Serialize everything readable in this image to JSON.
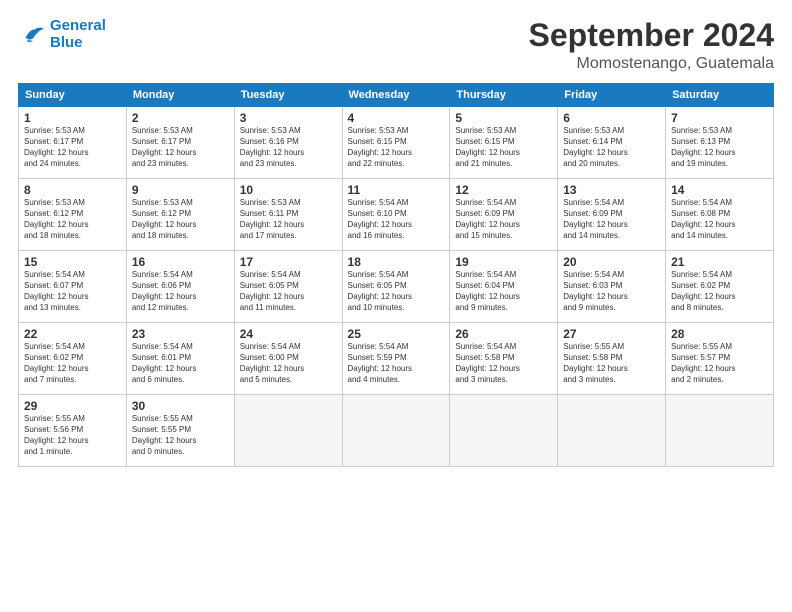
{
  "logo": {
    "line1": "General",
    "line2": "Blue"
  },
  "title": "September 2024",
  "subtitle": "Momostenango, Guatemala",
  "headers": [
    "Sunday",
    "Monday",
    "Tuesday",
    "Wednesday",
    "Thursday",
    "Friday",
    "Saturday"
  ],
  "weeks": [
    [
      {
        "num": "1",
        "info": "Sunrise: 5:53 AM\nSunset: 6:17 PM\nDaylight: 12 hours\nand 24 minutes."
      },
      {
        "num": "2",
        "info": "Sunrise: 5:53 AM\nSunset: 6:17 PM\nDaylight: 12 hours\nand 23 minutes."
      },
      {
        "num": "3",
        "info": "Sunrise: 5:53 AM\nSunset: 6:16 PM\nDaylight: 12 hours\nand 23 minutes."
      },
      {
        "num": "4",
        "info": "Sunrise: 5:53 AM\nSunset: 6:15 PM\nDaylight: 12 hours\nand 22 minutes."
      },
      {
        "num": "5",
        "info": "Sunrise: 5:53 AM\nSunset: 6:15 PM\nDaylight: 12 hours\nand 21 minutes."
      },
      {
        "num": "6",
        "info": "Sunrise: 5:53 AM\nSunset: 6:14 PM\nDaylight: 12 hours\nand 20 minutes."
      },
      {
        "num": "7",
        "info": "Sunrise: 5:53 AM\nSunset: 6:13 PM\nDaylight: 12 hours\nand 19 minutes."
      }
    ],
    [
      {
        "num": "8",
        "info": "Sunrise: 5:53 AM\nSunset: 6:12 PM\nDaylight: 12 hours\nand 18 minutes."
      },
      {
        "num": "9",
        "info": "Sunrise: 5:53 AM\nSunset: 6:12 PM\nDaylight: 12 hours\nand 18 minutes."
      },
      {
        "num": "10",
        "info": "Sunrise: 5:53 AM\nSunset: 6:11 PM\nDaylight: 12 hours\nand 17 minutes."
      },
      {
        "num": "11",
        "info": "Sunrise: 5:54 AM\nSunset: 6:10 PM\nDaylight: 12 hours\nand 16 minutes."
      },
      {
        "num": "12",
        "info": "Sunrise: 5:54 AM\nSunset: 6:09 PM\nDaylight: 12 hours\nand 15 minutes."
      },
      {
        "num": "13",
        "info": "Sunrise: 5:54 AM\nSunset: 6:09 PM\nDaylight: 12 hours\nand 14 minutes."
      },
      {
        "num": "14",
        "info": "Sunrise: 5:54 AM\nSunset: 6:08 PM\nDaylight: 12 hours\nand 14 minutes."
      }
    ],
    [
      {
        "num": "15",
        "info": "Sunrise: 5:54 AM\nSunset: 6:07 PM\nDaylight: 12 hours\nand 13 minutes."
      },
      {
        "num": "16",
        "info": "Sunrise: 5:54 AM\nSunset: 6:06 PM\nDaylight: 12 hours\nand 12 minutes."
      },
      {
        "num": "17",
        "info": "Sunrise: 5:54 AM\nSunset: 6:05 PM\nDaylight: 12 hours\nand 11 minutes."
      },
      {
        "num": "18",
        "info": "Sunrise: 5:54 AM\nSunset: 6:05 PM\nDaylight: 12 hours\nand 10 minutes."
      },
      {
        "num": "19",
        "info": "Sunrise: 5:54 AM\nSunset: 6:04 PM\nDaylight: 12 hours\nand 9 minutes."
      },
      {
        "num": "20",
        "info": "Sunrise: 5:54 AM\nSunset: 6:03 PM\nDaylight: 12 hours\nand 9 minutes."
      },
      {
        "num": "21",
        "info": "Sunrise: 5:54 AM\nSunset: 6:02 PM\nDaylight: 12 hours\nand 8 minutes."
      }
    ],
    [
      {
        "num": "22",
        "info": "Sunrise: 5:54 AM\nSunset: 6:02 PM\nDaylight: 12 hours\nand 7 minutes."
      },
      {
        "num": "23",
        "info": "Sunrise: 5:54 AM\nSunset: 6:01 PM\nDaylight: 12 hours\nand 6 minutes."
      },
      {
        "num": "24",
        "info": "Sunrise: 5:54 AM\nSunset: 6:00 PM\nDaylight: 12 hours\nand 5 minutes."
      },
      {
        "num": "25",
        "info": "Sunrise: 5:54 AM\nSunset: 5:59 PM\nDaylight: 12 hours\nand 4 minutes."
      },
      {
        "num": "26",
        "info": "Sunrise: 5:54 AM\nSunset: 5:58 PM\nDaylight: 12 hours\nand 3 minutes."
      },
      {
        "num": "27",
        "info": "Sunrise: 5:55 AM\nSunset: 5:58 PM\nDaylight: 12 hours\nand 3 minutes."
      },
      {
        "num": "28",
        "info": "Sunrise: 5:55 AM\nSunset: 5:57 PM\nDaylight: 12 hours\nand 2 minutes."
      }
    ],
    [
      {
        "num": "29",
        "info": "Sunrise: 5:55 AM\nSunset: 5:56 PM\nDaylight: 12 hours\nand 1 minute."
      },
      {
        "num": "30",
        "info": "Sunrise: 5:55 AM\nSunset: 5:55 PM\nDaylight: 12 hours\nand 0 minutes."
      },
      {
        "num": "",
        "info": ""
      },
      {
        "num": "",
        "info": ""
      },
      {
        "num": "",
        "info": ""
      },
      {
        "num": "",
        "info": ""
      },
      {
        "num": "",
        "info": ""
      }
    ]
  ]
}
